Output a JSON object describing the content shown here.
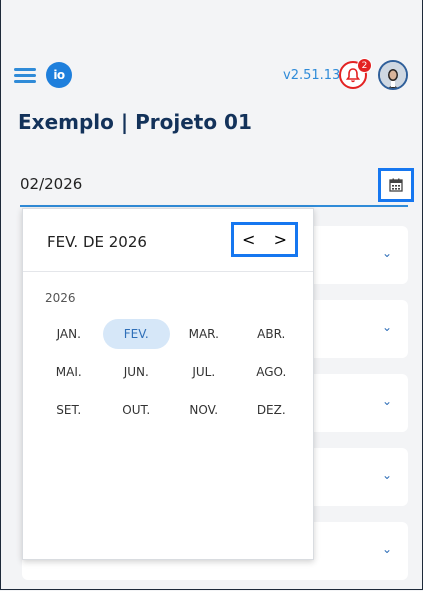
{
  "header": {
    "logo_text": "io",
    "version": "v2.51.13",
    "notification_count": "2"
  },
  "page_title": "Exemplo | Projeto 01",
  "date_field": {
    "value": "02/2026"
  },
  "picker": {
    "header_label": "FEV. DE 2026",
    "prev": "<",
    "next": ">",
    "year": "2026",
    "months": [
      "JAN.",
      "FEV.",
      "MAR.",
      "ABR.",
      "MAI.",
      "JUN.",
      "JUL.",
      "AGO.",
      "SET.",
      "OUT.",
      "NOV.",
      "DEZ."
    ],
    "selected_month": "FEV."
  },
  "accent_color": "#2f8bd8",
  "highlight_color": "#1677f0"
}
